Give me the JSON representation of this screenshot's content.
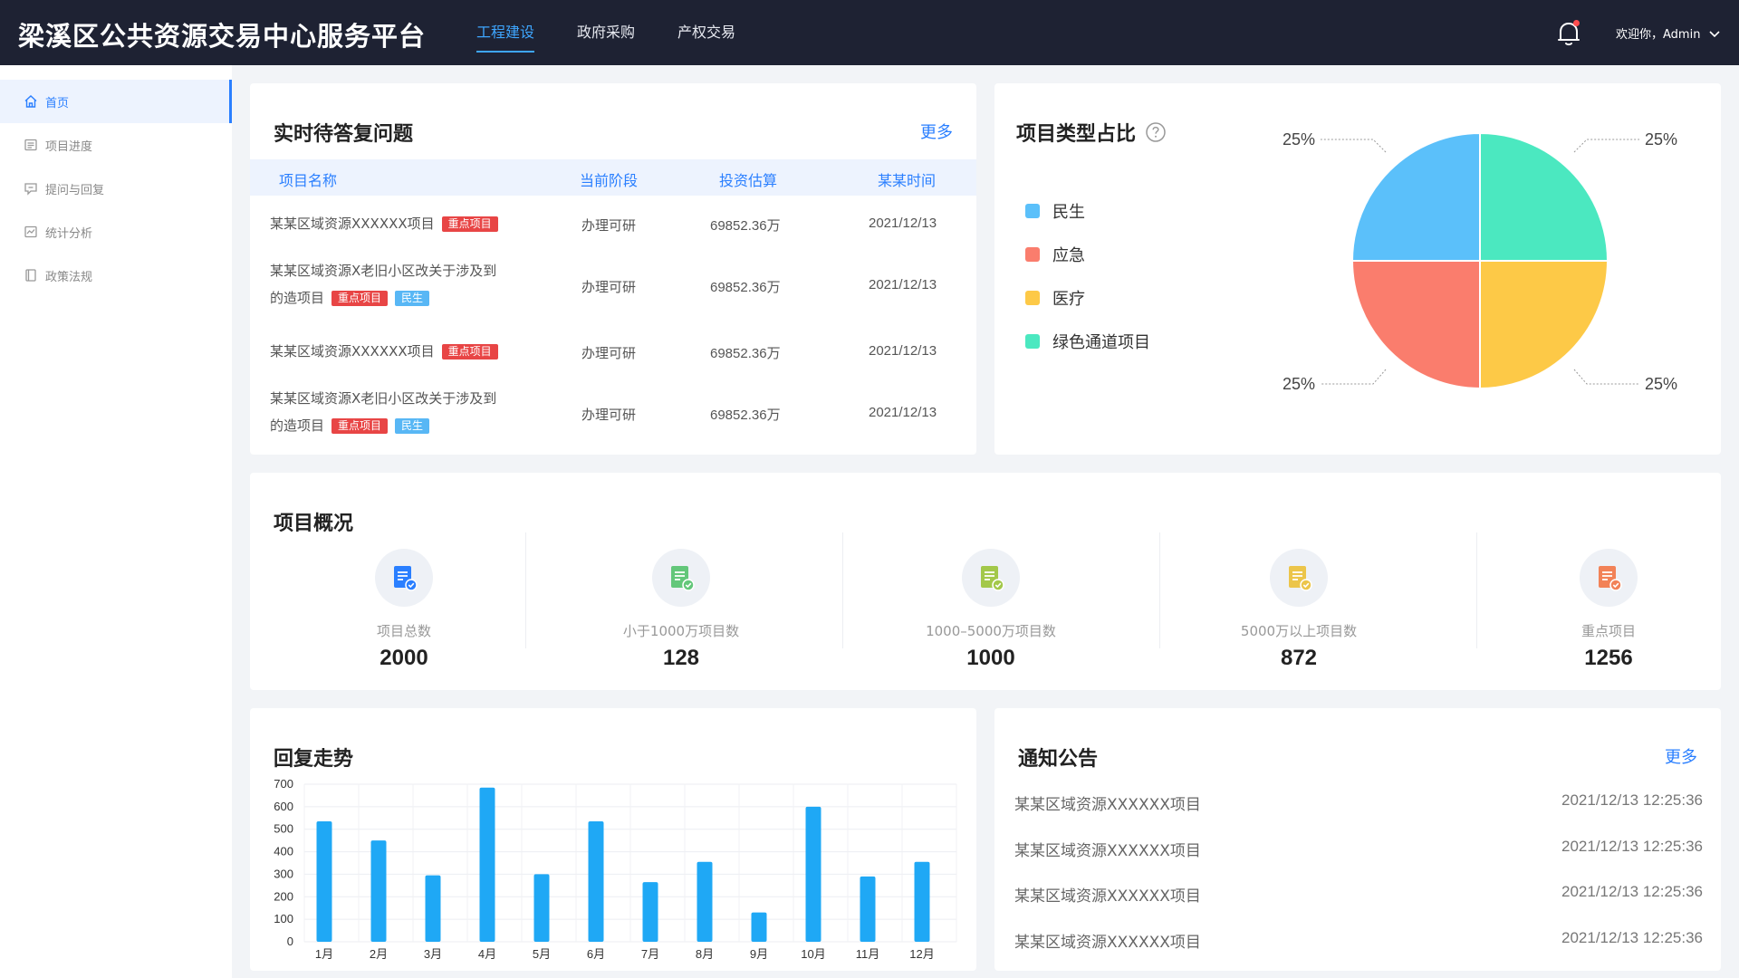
{
  "header": {
    "title": "梁溪区公共资源交易中心服务平台",
    "nav": [
      {
        "label": "工程建设",
        "active": true
      },
      {
        "label": "政府采购",
        "active": false
      },
      {
        "label": "产权交易",
        "active": false
      }
    ],
    "user_greeting": "欢迎你，Admin"
  },
  "sidebar": {
    "items": [
      {
        "label": "首页",
        "icon": "home-icon",
        "active": true
      },
      {
        "label": "项目进度",
        "icon": "list-icon",
        "active": false
      },
      {
        "label": "提问与回复",
        "icon": "message-icon",
        "active": false
      },
      {
        "label": "统计分析",
        "icon": "chart-icon",
        "active": false
      },
      {
        "label": "政策法规",
        "icon": "book-icon",
        "active": false
      }
    ]
  },
  "questions": {
    "title": "实时待答复问题",
    "more": "更多",
    "columns": [
      "项目名称",
      "当前阶段",
      "投资估算",
      "某某时间"
    ],
    "rows": [
      {
        "name_line1": "某某区域资源XXXXXX项目",
        "name_line2": "",
        "tags": [
          "重点项目"
        ],
        "stage": "办理可研",
        "amount": "69852.36万",
        "time": "2021/12/13"
      },
      {
        "name_line1": "某某区域资源X老旧小区改关于涉及到",
        "name_line2": "的造项目",
        "tags": [
          "重点项目",
          "民生"
        ],
        "stage": "办理可研",
        "amount": "69852.36万",
        "time": "2021/12/13"
      },
      {
        "name_line1": "某某区域资源XXXXXX项目",
        "name_line2": "",
        "tags": [
          "重点项目"
        ],
        "stage": "办理可研",
        "amount": "69852.36万",
        "time": "2021/12/13"
      },
      {
        "name_line1": "某某区域资源X老旧小区改关于涉及到",
        "name_line2": "的造项目",
        "tags": [
          "重点项目",
          "民生"
        ],
        "stage": "办理可研",
        "amount": "69852.36万",
        "time": "2021/12/13"
      }
    ],
    "tag_colors": {
      "重点项目": "#e84545",
      "民生": "#58b7f5"
    }
  },
  "project_types": {
    "title": "项目类型占比",
    "legend": [
      {
        "name": "民生",
        "color": "#5bc0fa",
        "value": 25,
        "label": "25%"
      },
      {
        "name": "应急",
        "color": "#fa7d6d",
        "value": 25,
        "label": "25%"
      },
      {
        "name": "医疗",
        "color": "#fdc947",
        "value": 25,
        "label": "25%"
      },
      {
        "name": "绿色通道项目",
        "color": "#4be8c0",
        "value": 25,
        "label": "25%"
      }
    ]
  },
  "overview": {
    "title": "项目概况",
    "stats": [
      {
        "label": "项目总数",
        "value": "2000",
        "color": "#2a7fff",
        "icon": "document-check-icon"
      },
      {
        "label": "小于1000万项目数",
        "value": "128",
        "color": "#63c77a",
        "icon": "document-check-icon"
      },
      {
        "label": "1000–5000万项目数",
        "value": "1000",
        "color": "#a3c84a",
        "icon": "document-check-icon"
      },
      {
        "label": "5000万以上项目数",
        "value": "872",
        "color": "#ecc54a",
        "icon": "document-check-icon"
      },
      {
        "label": "重点项目",
        "value": "1256",
        "color": "#f28257",
        "icon": "document-check-icon"
      }
    ]
  },
  "trend": {
    "title": "回复走势"
  },
  "chart_data": {
    "type": "bar",
    "categories": [
      "1月",
      "2月",
      "3月",
      "4月",
      "5月",
      "6月",
      "7月",
      "8月",
      "9月",
      "10月",
      "11月",
      "12月"
    ],
    "values": [
      535,
      450,
      295,
      685,
      300,
      535,
      265,
      355,
      130,
      600,
      290,
      355
    ],
    "ylim": [
      0,
      700
    ],
    "yticks": [
      0,
      100,
      200,
      300,
      400,
      500,
      600,
      700
    ],
    "grid": true,
    "color": "#1fa8f5"
  },
  "notices": {
    "title": "通知公告",
    "more": "更多",
    "items": [
      {
        "title": "某某区域资源XXXXXX项目",
        "date": "2021/12/13 12:25:36"
      },
      {
        "title": "某某区域资源XXXXXX项目",
        "date": "2021/12/13 12:25:36"
      },
      {
        "title": "某某区域资源XXXXXX项目",
        "date": "2021/12/13 12:25:36"
      },
      {
        "title": "某某区域资源XXXXXX项目",
        "date": "2021/12/13 12:25:36"
      }
    ]
  }
}
